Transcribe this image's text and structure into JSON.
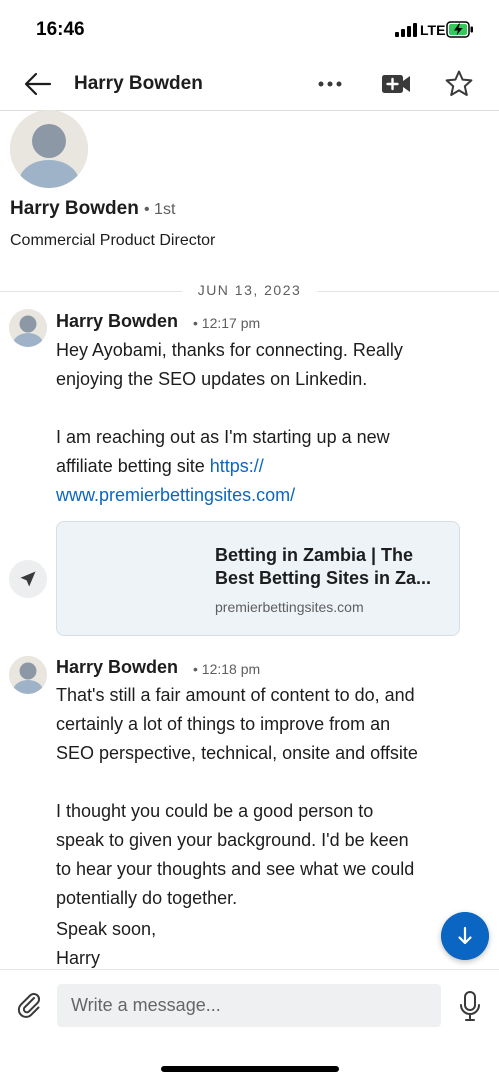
{
  "status_bar": {
    "time": "16:46",
    "network": "LTE"
  },
  "nav": {
    "title": "Harry Bowden"
  },
  "profile": {
    "name": "Harry Bowden",
    "degree": "• 1st",
    "headline": "Commercial Product Director"
  },
  "date_divider": "JUN 13, 2023",
  "messages": [
    {
      "sender": "Harry Bowden",
      "time": "• 12:17 pm",
      "lines": [
        "Hey Ayobami, thanks for connecting. Really",
        "enjoying the SEO updates on Linkedin.",
        "",
        "I am reaching out as I'm starting up a new",
        "affiliate betting site"
      ],
      "link_part1": "https://",
      "link_part2": "www.premierbettingsites.com/",
      "card": {
        "title_line1": "Betting in Zambia | The",
        "title_line2": "Best Betting Sites in Za...",
        "domain": "premierbettingsites.com"
      }
    },
    {
      "sender": "Harry Bowden",
      "time": "• 12:18 pm",
      "lines": [
        "That's still a fair amount of content to do, and",
        "certainly a lot of things to improve from an",
        "SEO perspective, technical, onsite and offsite",
        "",
        "I thought you could be a good person to",
        "speak to given your background. I'd be keen",
        "to hear your thoughts and see what we could",
        "potentially do together.",
        "Speak soon,",
        "Harry"
      ]
    }
  ],
  "composer": {
    "placeholder": "Write a message..."
  },
  "colors": {
    "accent": "#0a66c2",
    "battery_charging": "#34c759"
  },
  "icons": [
    "back-arrow-icon",
    "more-icon",
    "video-call-icon",
    "star-icon",
    "send-icon",
    "scroll-down-icon",
    "attachment-icon",
    "microphone-icon"
  ]
}
